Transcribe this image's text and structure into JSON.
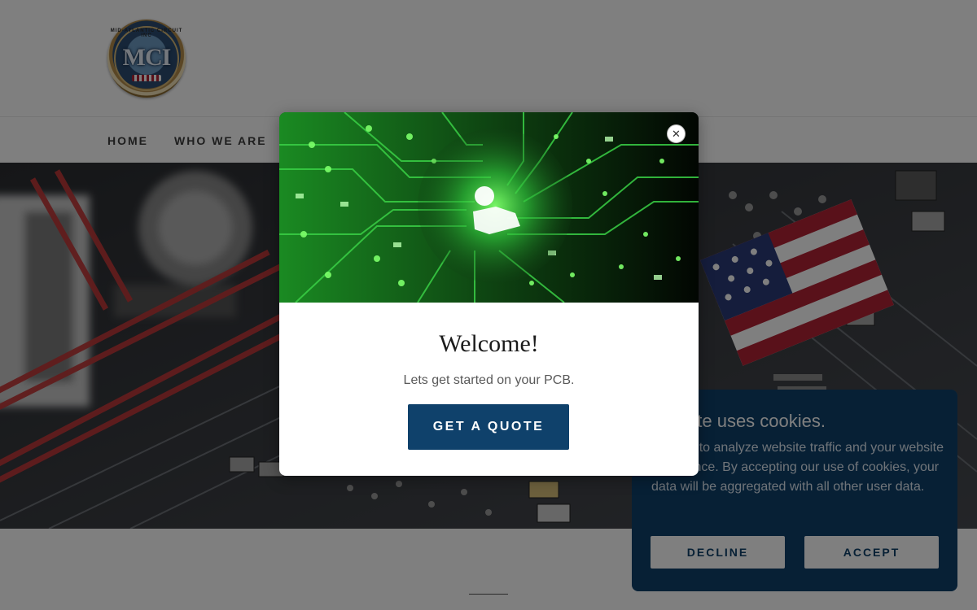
{
  "header": {
    "logo_text": "MCI",
    "logo_arc_text": "MID-ATLANTIC CIRCUIT INC"
  },
  "nav": {
    "items": [
      {
        "label": "HOME"
      },
      {
        "label": "WHO WE ARE"
      }
    ]
  },
  "modal": {
    "title": "Welcome!",
    "subtitle": "Lets get started on your PCB.",
    "cta_label": "GET A QUOTE",
    "close_icon": "close-icon",
    "image_icon": "user-icon"
  },
  "cookie_banner": {
    "title_visible": "website uses cookies.",
    "body_visible": "cookies to analyze website traffic and your website experience. By accepting our use of cookies, your data will be aggregated with all other user data.",
    "decline_label": "DECLINE",
    "accept_label": "ACCEPT"
  },
  "colors": {
    "brand_blue": "#0f416b",
    "overlay": "rgba(0,0,0,0.5)",
    "circuit_green": "#2fbf3a",
    "flag_red": "#b22234"
  }
}
